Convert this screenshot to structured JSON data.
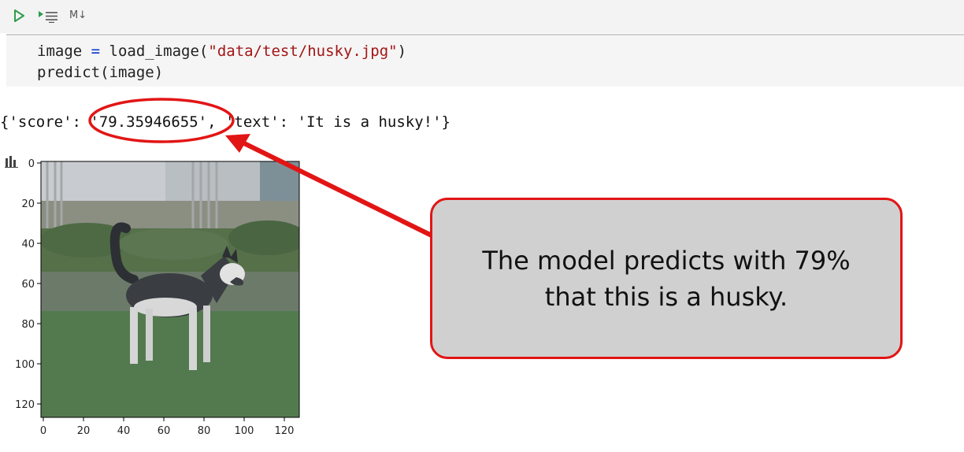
{
  "toolbar": {
    "run_icon": "play-icon",
    "run_all_icon": "run-all-icon",
    "markdown_label": "M↓"
  },
  "code": {
    "line1": {
      "var": "image ",
      "op": "=",
      "fn": " load_image(",
      "str": "\"data/test/husky.jpg\"",
      "close": ")"
    },
    "line2": "predict(image)"
  },
  "output": {
    "prefix": "{'score': ",
    "score": "'79.35946655'",
    "suffix": ", 'text': 'It is a husky!'}"
  },
  "plot": {
    "icon": "bar-chart-icon",
    "y_ticks": [
      "0",
      "20",
      "40",
      "60",
      "80",
      "100",
      "120"
    ],
    "x_ticks": [
      "0",
      "20",
      "40",
      "60",
      "80",
      "100",
      "120"
    ],
    "image_subject": "husky dog on grass"
  },
  "callout": {
    "line1": "The model predicts with 79%",
    "line2": "that this is a husky."
  },
  "colors": {
    "highlight": "#e21515",
    "callout_bg": "#d0d0d0",
    "run": "#2e9c4a"
  }
}
